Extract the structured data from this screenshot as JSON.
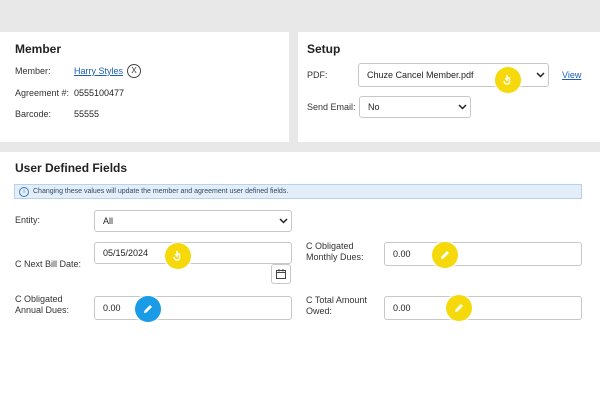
{
  "member": {
    "title": "Member",
    "member_label": "Member:",
    "member_name": "Harry Styles",
    "remove_glyph": "X",
    "agreement_label": "Agreement #:",
    "agreement_value": "0555100477",
    "barcode_label": "Barcode:",
    "barcode_value": "55555"
  },
  "setup": {
    "title": "Setup",
    "pdf_label": "PDF:",
    "pdf_selected": "Chuze Cancel Member.pdf",
    "view_link": "View",
    "send_email_label": "Send Email:",
    "send_email_selected": "No"
  },
  "udf": {
    "title": "User Defined Fields",
    "info_text": "Changing these values will update the member and agreement user defined fields.",
    "info_glyph": "i",
    "entity_label": "Entity:",
    "entity_selected": "All",
    "next_bill_label": "C Next Bill Date:",
    "next_bill_value": "05/15/2024",
    "obl_monthly_label": "C Obligated Monthly Dues:",
    "obl_monthly_value": "0.00",
    "obl_annual_label": "C Obligated Annual Dues:",
    "obl_annual_value": "0.00",
    "total_owed_label": "C Total Amount Owed:",
    "total_owed_value": "0.00"
  },
  "colors": {
    "link": "#1a5fb4",
    "badge_yellow": "#f5d90a",
    "badge_blue": "#1a9be6",
    "info_bg": "#e3eef9"
  },
  "icons": [
    "close-circle-icon",
    "chevron-down-icon",
    "info-icon",
    "calendar-icon",
    "pencil-icon",
    "pointer-hand-icon"
  ]
}
